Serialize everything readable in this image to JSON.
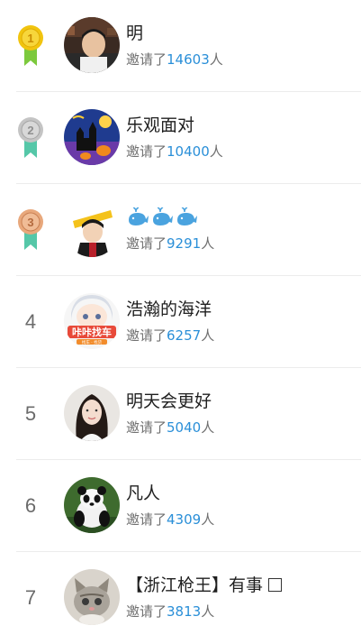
{
  "invite_prefix": "邀请了",
  "invite_suffix": "人",
  "entries": [
    {
      "rank": "1",
      "name": "明",
      "count": "14603",
      "medal": "gold",
      "avatar": "boy-photo"
    },
    {
      "rank": "2",
      "name": "乐观面对",
      "count": "10400",
      "medal": "silver",
      "avatar": "halloween-castle"
    },
    {
      "rank": "3",
      "name": "",
      "count": "9291",
      "medal": "bronze",
      "avatar": "anime-pirate",
      "name_icons": [
        "whale-icon",
        "whale-icon",
        "whale-icon"
      ]
    },
    {
      "rank": "4",
      "name": "浩瀚的海洋",
      "count": "6257",
      "medal": "",
      "avatar": "anime-girl-sticker",
      "sticker_text": "咔咔找车",
      "sticker_small": "找车 · 找货"
    },
    {
      "rank": "5",
      "name": "明天会更好",
      "count": "5040",
      "medal": "",
      "avatar": "woman-photo"
    },
    {
      "rank": "6",
      "name": "凡人",
      "count": "4309",
      "medal": "",
      "avatar": "panda-photo"
    },
    {
      "rank": "7",
      "name": "【浙江枪王】有事",
      "count": "3813",
      "medal": "",
      "avatar": "kitten-photo",
      "name_suffix_icon": "box-glyph"
    }
  ],
  "colors": {
    "gold": "#f1c40f",
    "silver": "#b9b9b9",
    "bronze": "#e8a87c",
    "ribbon": "#55c7a8",
    "ribbon_gold": "#7cc93d",
    "count": "#2a8fd8"
  }
}
